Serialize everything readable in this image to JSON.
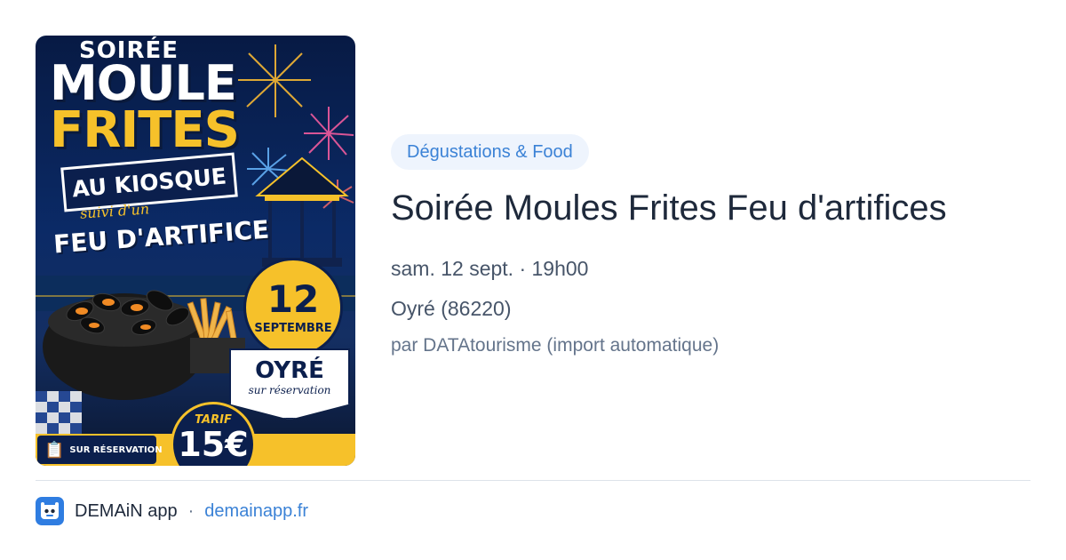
{
  "poster": {
    "soiree": "SOIRÉE",
    "moule": "MOULE",
    "frites": "FRITES",
    "kiosque": "AU KIOSQUE",
    "suivi": "suivi d'un",
    "feu": "FEU D'ARTIFICE",
    "day": "12",
    "month": "SEPTEMBRE",
    "town": "OYRÉ",
    "town_note": "sur réservation",
    "reservation": "SUR RÉSERVATION",
    "tarif_label": "TARIF",
    "price": "15€"
  },
  "event": {
    "category": "Dégustations & Food",
    "title": "Soirée Moules Frites Feu d'artifices",
    "datetime": "sam. 12 sept. · 19h00",
    "location": "Oyré (86220)",
    "source": "par DATAtourisme (import automatique)"
  },
  "footer": {
    "app_name": "DEMAiN app",
    "separator": "·",
    "url": "demainapp.fr"
  },
  "colors": {
    "accent": "#3b82d6",
    "pill_bg": "#eef4fd",
    "poster_yellow": "#f6c12a",
    "poster_navy": "#0b1f4d"
  }
}
